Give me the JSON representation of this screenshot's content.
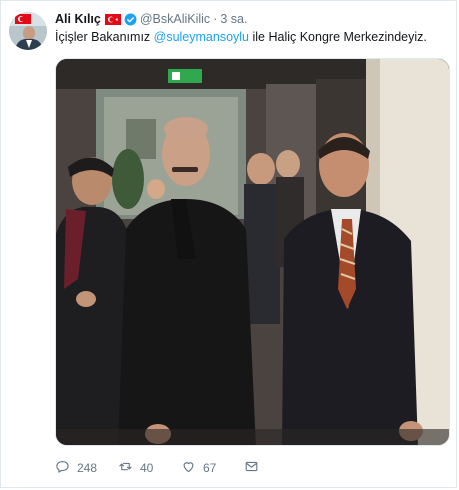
{
  "tweet": {
    "display_name": "Ali Kılıç",
    "handle": "@BskAliKilic",
    "separator": "·",
    "time": "3 sa.",
    "text_before": "İçişler Bakanımız ",
    "mention": "@suleymansoylu",
    "text_after": " ile Haliç Kongre Merkezindeyiz.",
    "icons": {
      "flag": "turkey-flag-icon",
      "verified": "verified-badge-icon"
    }
  },
  "actions": {
    "reply_count": "248",
    "retweet_count": "40",
    "like_count": "67",
    "icons": [
      "reply-icon",
      "retweet-icon",
      "like-icon",
      "direct-message-icon"
    ]
  },
  "colors": {
    "link": "#1da1f2",
    "secondary_text": "#657786",
    "verified": "#1da1f2",
    "flag": "#e30a17"
  }
}
